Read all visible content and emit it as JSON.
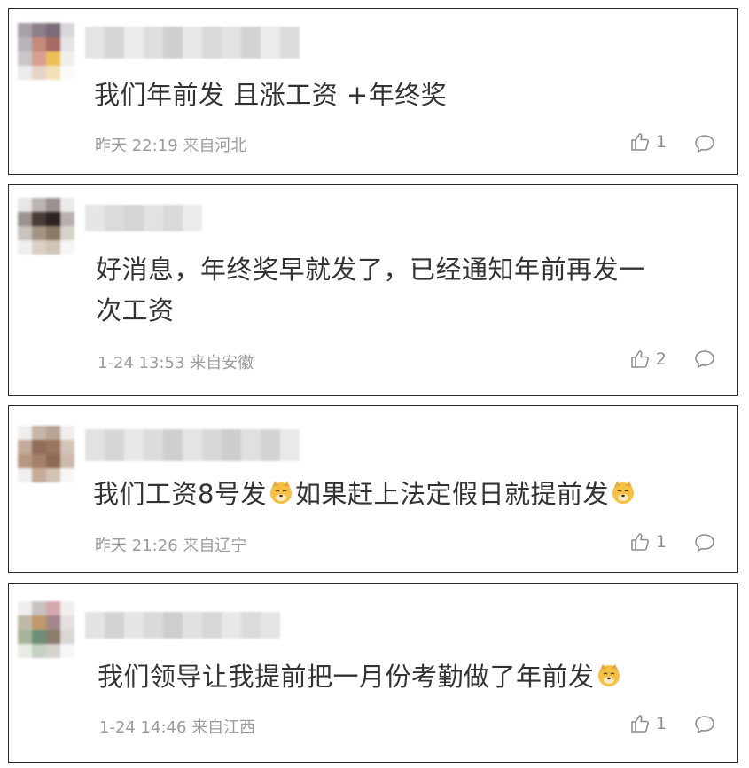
{
  "colors": {
    "text": "#333333",
    "meta": "#9b9b9b",
    "border": "#2a2a2a",
    "emoji": "#f5c043"
  },
  "icons": {
    "like": "thumbs-up-icon",
    "comment": "speech-bubble-icon",
    "emoji": "doge-face-emoji"
  },
  "comments": [
    {
      "text": "我们年前发 且涨工资 +年终奖",
      "time": "昨天 22:19",
      "location": "来自河北",
      "likes": "1"
    },
    {
      "text_line1": "好消息，年终奖早就发了，已经通知年前再发一",
      "text_line2": "次工资",
      "time": "1-24 13:53",
      "location": "来自安徽",
      "likes": "2"
    },
    {
      "text_part1": "我们工资8号发",
      "text_part2": "如果赶上法定假日就提前发",
      "time": "昨天 21:26",
      "location": "来自辽宁",
      "likes": "1"
    },
    {
      "text_part1": "我们领导让我提前把一月份考勤做了年前发",
      "time": "1-24 14:46",
      "location": "来自江西",
      "likes": "1"
    }
  ]
}
